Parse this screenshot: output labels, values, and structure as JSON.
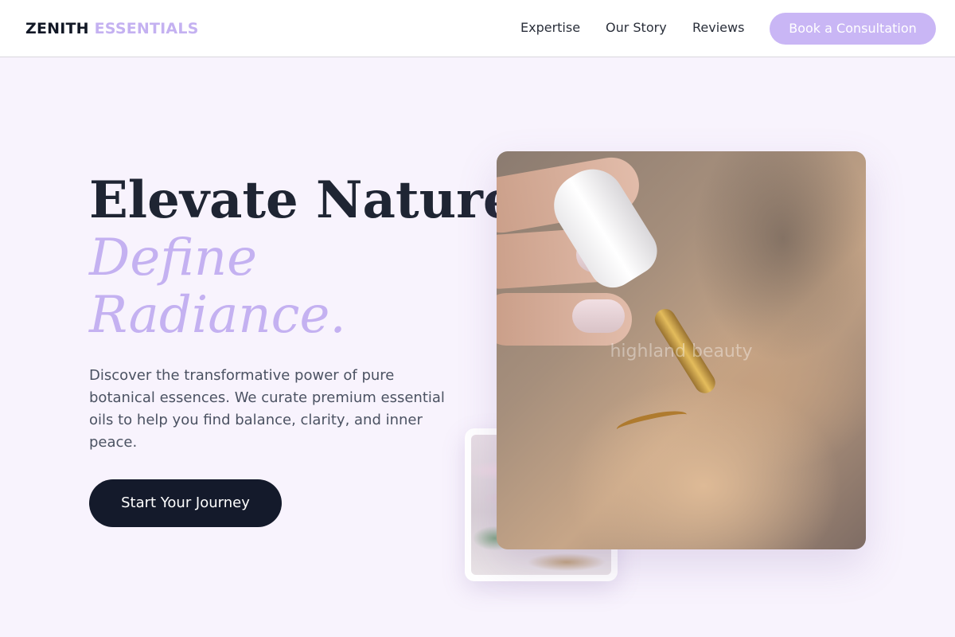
{
  "header": {
    "brand_primary": "ZENITH",
    "brand_accent": "ESSENTIALS",
    "nav": [
      "Expertise",
      "Our Story",
      "Reviews"
    ],
    "cta_label": "Book a Consultation"
  },
  "hero": {
    "headline_line1": "Elevate Nature,",
    "headline_line2": "Define",
    "headline_line3": "Radiance.",
    "description_lines": [
      "Discover the transformative power of pure",
      "botanical essences. We curate premium essential",
      "oils to help you find balance, clarity, and inner",
      "peace."
    ],
    "primary_button_label": "Start Your Journey",
    "image_watermark": "highland beauty"
  },
  "colors": {
    "background": "#f8f3fd",
    "accent_lavender": "#c4b1f1",
    "dark_navy": "#141a2b"
  }
}
